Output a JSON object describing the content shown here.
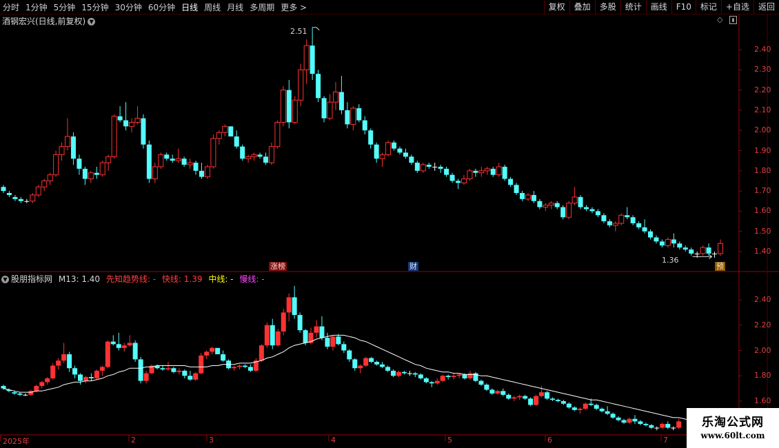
{
  "toolbar": {
    "periods": [
      {
        "label": "分时",
        "active": false
      },
      {
        "label": "1分钟",
        "active": false
      },
      {
        "label": "5分钟",
        "active": false
      },
      {
        "label": "15分钟",
        "active": false
      },
      {
        "label": "30分钟",
        "active": false
      },
      {
        "label": "60分钟",
        "active": false
      },
      {
        "label": "日线",
        "active": true
      },
      {
        "label": "周线",
        "active": false
      },
      {
        "label": "月线",
        "active": false
      },
      {
        "label": "多周期",
        "active": false
      },
      {
        "label": "更多 >",
        "active": false
      }
    ],
    "tools": [
      "复权",
      "叠加",
      "多股",
      "统计",
      "画线",
      "F10",
      "标记",
      "+自选",
      "返回"
    ]
  },
  "main": {
    "title": "酒钢宏兴(日线,前复权)",
    "high_label": "2.51",
    "low_label": "1.36",
    "yaxis": [
      "2.40",
      "2.30",
      "2.20",
      "2.10",
      "2.00",
      "1.90",
      "1.80",
      "1.70",
      "1.60",
      "1.50",
      "1.40"
    ],
    "markers": {
      "zhangbang": "涨榜",
      "cai": "财",
      "yu": "预"
    }
  },
  "indicator": {
    "name": "股朋指标网",
    "m13": "M13: 1.40",
    "leading": "先知趋势线: -",
    "fast": "快线: 1.39",
    "mid": "中线: -",
    "slow": "慢线: -",
    "yaxis": [
      "2.40",
      "2.20",
      "2.00",
      "1.80",
      "1.60"
    ]
  },
  "dateaxis": [
    "2025年",
    "2",
    "3",
    "4",
    "5",
    "6",
    "7"
  ],
  "watermark": {
    "line1": "乐淘公式网",
    "line2": "www.60lt.com"
  },
  "colors": {
    "up": "#ff3232",
    "down": "#54fcfc",
    "flat": "#ffffff",
    "grid_red": "#8b0000",
    "ma": "#ffffff",
    "leading": "#ff4040",
    "fast": "#ff4040",
    "mid": "#ffff00",
    "slow": "#ff44ff"
  },
  "chart_data": {
    "type": "candlestick",
    "high_marker": 2.51,
    "low_marker": 1.36,
    "ohlc": [
      [
        1.72,
        1.73,
        1.69,
        1.7
      ],
      [
        1.69,
        1.7,
        1.67,
        1.68
      ],
      [
        1.67,
        1.68,
        1.65,
        1.66
      ],
      [
        1.66,
        1.67,
        1.64,
        1.65
      ],
      [
        1.65,
        1.66,
        1.64,
        1.65
      ],
      [
        1.65,
        1.69,
        1.64,
        1.68
      ],
      [
        1.68,
        1.73,
        1.67,
        1.72
      ],
      [
        1.72,
        1.76,
        1.7,
        1.75
      ],
      [
        1.75,
        1.79,
        1.73,
        1.78
      ],
      [
        1.78,
        1.9,
        1.77,
        1.88
      ],
      [
        1.88,
        1.94,
        1.85,
        1.92
      ],
      [
        1.92,
        2.06,
        1.9,
        1.97
      ],
      [
        1.97,
        1.99,
        1.83,
        1.86
      ],
      [
        1.86,
        1.88,
        1.78,
        1.81
      ],
      [
        1.81,
        1.82,
        1.73,
        1.76
      ],
      [
        1.76,
        1.8,
        1.74,
        1.79
      ],
      [
        1.79,
        1.82,
        1.76,
        1.78
      ],
      [
        1.78,
        1.85,
        1.77,
        1.84
      ],
      [
        1.84,
        1.88,
        1.8,
        1.87
      ],
      [
        1.87,
        2.08,
        1.86,
        2.07
      ],
      [
        2.07,
        2.12,
        2.04,
        2.05
      ],
      [
        2.05,
        2.14,
        2.0,
        2.02
      ],
      [
        2.02,
        2.06,
        1.99,
        2.04
      ],
      [
        2.04,
        2.12,
        2.03,
        2.06
      ],
      [
        2.06,
        2.08,
        1.91,
        1.93
      ],
      [
        1.93,
        1.95,
        1.74,
        1.76
      ],
      [
        1.76,
        1.84,
        1.74,
        1.82
      ],
      [
        1.82,
        1.89,
        1.81,
        1.88
      ],
      [
        1.88,
        1.89,
        1.85,
        1.86
      ],
      [
        1.86,
        1.88,
        1.84,
        1.85
      ],
      [
        1.85,
        1.91,
        1.84,
        1.86
      ],
      [
        1.86,
        1.87,
        1.82,
        1.83
      ],
      [
        1.83,
        1.86,
        1.81,
        1.84
      ],
      [
        1.84,
        1.85,
        1.78,
        1.8
      ],
      [
        1.8,
        1.84,
        1.76,
        1.77
      ],
      [
        1.77,
        1.83,
        1.76,
        1.82
      ],
      [
        1.82,
        1.98,
        1.81,
        1.96
      ],
      [
        1.96,
        2.0,
        1.93,
        1.99
      ],
      [
        1.99,
        2.03,
        1.97,
        2.02
      ],
      [
        2.02,
        2.02,
        1.97,
        1.97
      ],
      [
        1.97,
        2.0,
        1.91,
        1.92
      ],
      [
        1.92,
        1.93,
        1.85,
        1.86
      ],
      [
        1.86,
        1.88,
        1.84,
        1.87
      ],
      [
        1.87,
        1.89,
        1.85,
        1.88
      ],
      [
        1.88,
        1.89,
        1.86,
        1.87
      ],
      [
        1.87,
        1.89,
        1.83,
        1.84
      ],
      [
        1.84,
        1.94,
        1.83,
        1.92
      ],
      [
        1.92,
        2.05,
        1.91,
        2.04
      ],
      [
        2.04,
        2.22,
        2.02,
        2.2
      ],
      [
        2.2,
        2.25,
        2.01,
        2.04
      ],
      [
        2.04,
        2.17,
        2.03,
        2.15
      ],
      [
        2.15,
        2.33,
        2.12,
        2.3
      ],
      [
        2.3,
        2.45,
        2.23,
        2.42
      ],
      [
        2.42,
        2.51,
        2.25,
        2.28
      ],
      [
        2.28,
        2.3,
        2.14,
        2.16
      ],
      [
        2.16,
        2.17,
        2.04,
        2.06
      ],
      [
        2.06,
        2.18,
        2.05,
        2.14
      ],
      [
        2.14,
        2.24,
        2.1,
        2.19
      ],
      [
        2.19,
        2.27,
        2.08,
        2.1
      ],
      [
        2.1,
        2.14,
        2.01,
        2.03
      ],
      [
        2.03,
        2.12,
        2.0,
        2.11
      ],
      [
        2.11,
        2.13,
        2.04,
        2.05
      ],
      [
        2.05,
        2.07,
        1.98,
        2.0
      ],
      [
        2.0,
        2.01,
        1.91,
        1.93
      ],
      [
        1.93,
        1.94,
        1.84,
        1.86
      ],
      [
        1.86,
        1.89,
        1.82,
        1.88
      ],
      [
        1.88,
        1.95,
        1.87,
        1.94
      ],
      [
        1.94,
        1.95,
        1.9,
        1.91
      ],
      [
        1.91,
        1.92,
        1.88,
        1.89
      ],
      [
        1.89,
        1.91,
        1.86,
        1.87
      ],
      [
        1.87,
        1.88,
        1.83,
        1.84
      ],
      [
        1.84,
        1.85,
        1.79,
        1.8
      ],
      [
        1.8,
        1.84,
        1.79,
        1.83
      ],
      [
        1.83,
        1.84,
        1.81,
        1.82
      ],
      [
        1.82,
        1.84,
        1.8,
        1.82
      ],
      [
        1.82,
        1.83,
        1.79,
        1.81
      ],
      [
        1.81,
        1.82,
        1.77,
        1.78
      ],
      [
        1.78,
        1.79,
        1.74,
        1.75
      ],
      [
        1.75,
        1.76,
        1.71,
        1.74
      ],
      [
        1.74,
        1.78,
        1.73,
        1.76
      ],
      [
        1.76,
        1.81,
        1.75,
        1.8
      ],
      [
        1.8,
        1.81,
        1.77,
        1.79
      ],
      [
        1.79,
        1.82,
        1.77,
        1.8
      ],
      [
        1.8,
        1.82,
        1.78,
        1.81
      ],
      [
        1.81,
        1.82,
        1.77,
        1.78
      ],
      [
        1.78,
        1.84,
        1.77,
        1.82
      ],
      [
        1.82,
        1.83,
        1.75,
        1.76
      ],
      [
        1.76,
        1.77,
        1.72,
        1.73
      ],
      [
        1.73,
        1.74,
        1.68,
        1.69
      ],
      [
        1.69,
        1.7,
        1.65,
        1.66
      ],
      [
        1.66,
        1.69,
        1.65,
        1.68
      ],
      [
        1.68,
        1.7,
        1.64,
        1.65
      ],
      [
        1.65,
        1.66,
        1.61,
        1.62
      ],
      [
        1.62,
        1.64,
        1.6,
        1.63
      ],
      [
        1.63,
        1.65,
        1.61,
        1.64
      ],
      [
        1.64,
        1.65,
        1.61,
        1.62
      ],
      [
        1.62,
        1.63,
        1.56,
        1.57
      ],
      [
        1.57,
        1.65,
        1.56,
        1.64
      ],
      [
        1.64,
        1.72,
        1.63,
        1.67
      ],
      [
        1.67,
        1.68,
        1.61,
        1.62
      ],
      [
        1.62,
        1.63,
        1.6,
        1.61
      ],
      [
        1.61,
        1.62,
        1.59,
        1.6
      ],
      [
        1.6,
        1.61,
        1.57,
        1.58
      ],
      [
        1.58,
        1.59,
        1.54,
        1.55
      ],
      [
        1.55,
        1.56,
        1.52,
        1.53
      ],
      [
        1.53,
        1.55,
        1.5,
        1.54
      ],
      [
        1.54,
        1.59,
        1.53,
        1.58
      ],
      [
        1.58,
        1.62,
        1.56,
        1.57
      ],
      [
        1.57,
        1.58,
        1.53,
        1.54
      ],
      [
        1.54,
        1.55,
        1.51,
        1.52
      ],
      [
        1.52,
        1.56,
        1.49,
        1.5
      ],
      [
        1.5,
        1.51,
        1.46,
        1.47
      ],
      [
        1.47,
        1.48,
        1.44,
        1.45
      ],
      [
        1.45,
        1.46,
        1.42,
        1.43
      ],
      [
        1.43,
        1.47,
        1.42,
        1.46
      ],
      [
        1.46,
        1.49,
        1.42,
        1.44
      ],
      [
        1.44,
        1.45,
        1.41,
        1.42
      ],
      [
        1.42,
        1.43,
        1.4,
        1.41
      ],
      [
        1.41,
        1.42,
        1.38,
        1.39
      ],
      [
        1.39,
        1.4,
        1.37,
        1.39
      ],
      [
        1.39,
        1.43,
        1.38,
        1.42
      ],
      [
        1.42,
        1.44,
        1.38,
        1.39
      ],
      [
        1.39,
        1.4,
        1.37,
        1.39
      ],
      [
        1.39,
        1.46,
        1.38,
        1.44
      ]
    ],
    "ma13": [
      1.7,
      1.69,
      1.68,
      1.67,
      1.67,
      1.67,
      1.68,
      1.68,
      1.69,
      1.7,
      1.71,
      1.73,
      1.74,
      1.75,
      1.75,
      1.76,
      1.76,
      1.77,
      1.78,
      1.8,
      1.81,
      1.83,
      1.84,
      1.86,
      1.86,
      1.86,
      1.87,
      1.87,
      1.88,
      1.88,
      1.88,
      1.88,
      1.88,
      1.88,
      1.87,
      1.87,
      1.87,
      1.87,
      1.88,
      1.88,
      1.89,
      1.89,
      1.89,
      1.9,
      1.9,
      1.9,
      1.91,
      1.92,
      1.94,
      1.95,
      1.97,
      1.99,
      2.02,
      2.04,
      2.05,
      2.06,
      2.07,
      2.09,
      2.1,
      2.11,
      2.12,
      2.12,
      2.12,
      2.11,
      2.1,
      2.08,
      2.07,
      2.05,
      2.03,
      2.01,
      1.99,
      1.97,
      1.95,
      1.93,
      1.91,
      1.89,
      1.88,
      1.86,
      1.85,
      1.84,
      1.83,
      1.83,
      1.82,
      1.82,
      1.81,
      1.81,
      1.81,
      1.8,
      1.8,
      1.79,
      1.78,
      1.77,
      1.76,
      1.75,
      1.74,
      1.73,
      1.72,
      1.71,
      1.7,
      1.69,
      1.68,
      1.67,
      1.66,
      1.65,
      1.64,
      1.63,
      1.62,
      1.61,
      1.61,
      1.6,
      1.59,
      1.58,
      1.57,
      1.56,
      1.55,
      1.54,
      1.53,
      1.52,
      1.51,
      1.5,
      1.49,
      1.48,
      1.47,
      1.47,
      1.46,
      1.45,
      1.44
    ]
  }
}
